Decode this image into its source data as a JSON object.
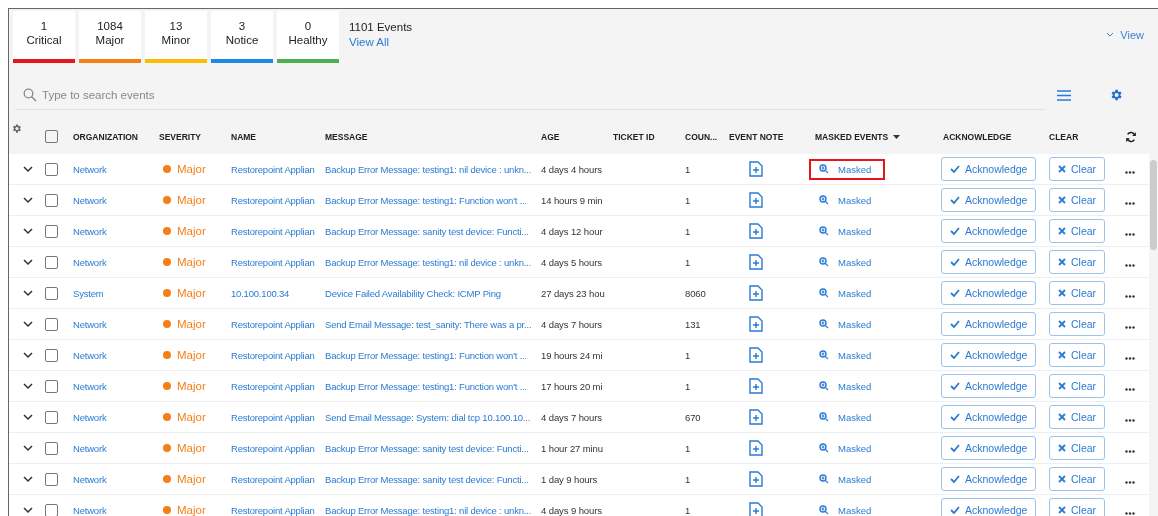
{
  "summary": [
    {
      "count": "1",
      "label": "Critical",
      "color": "#e8141c"
    },
    {
      "count": "1084",
      "label": "Major",
      "color": "#f57f17"
    },
    {
      "count": "13",
      "label": "Minor",
      "color": "#fbbc05"
    },
    {
      "count": "3",
      "label": "Notice",
      "color": "#1e88e5"
    },
    {
      "count": "0",
      "label": "Healthy",
      "color": "#4caf50"
    }
  ],
  "total_events": "1101 Events",
  "view_all": "View All",
  "view_button": "View",
  "search": {
    "placeholder": "Type to search events"
  },
  "select_all_checked": false,
  "columns": [
    {
      "label": "ORGANIZATION",
      "sorted": false
    },
    {
      "label": "SEVERITY",
      "sorted": false
    },
    {
      "label": "NAME",
      "sorted": false
    },
    {
      "label": "MESSAGE",
      "sorted": false
    },
    {
      "label": "AGE",
      "sorted": false
    },
    {
      "label": "TICKET ID",
      "sorted": false
    },
    {
      "label": "COUN...",
      "sorted": false
    },
    {
      "label": "EVENT NOTE",
      "sorted": false
    },
    {
      "label": "MASKED EVENTS",
      "sorted": true
    },
    {
      "label": "ACKNOWLEDGE",
      "sorted": false
    },
    {
      "label": "CLEAR",
      "sorted": false
    }
  ],
  "rows": [
    {
      "organization": "Network",
      "severity": "Major",
      "color": "#f57f17",
      "name": "Restorepoint Applian",
      "message": "Backup Error Message: testing1: nil device : unkn...",
      "age": "4 days 4 hours",
      "count": "1",
      "masked": "Masked",
      "highlighted": true,
      "acknowledge": "Acknowledge",
      "clear": "Clear",
      "checked": false
    },
    {
      "organization": "Network",
      "severity": "Major",
      "color": "#f57f17",
      "name": "Restorepoint Applian",
      "message": "Backup Error Message: testing1: Function won't ...",
      "age": "14 hours 9 min",
      "count": "1",
      "masked": "Masked",
      "highlighted": false,
      "acknowledge": "Acknowledge",
      "clear": "Clear",
      "checked": false
    },
    {
      "organization": "Network",
      "severity": "Major",
      "color": "#f57f17",
      "name": "Restorepoint Applian",
      "message": "Backup Error Message: sanity test device: Functi...",
      "age": "4 days 12 hour",
      "count": "1",
      "masked": "Masked",
      "highlighted": false,
      "acknowledge": "Acknowledge",
      "clear": "Clear",
      "checked": false
    },
    {
      "organization": "Network",
      "severity": "Major",
      "color": "#f57f17",
      "name": "Restorepoint Applian",
      "message": "Backup Error Message: testing1: nil device : unkn...",
      "age": "4 days 5 hours",
      "count": "1",
      "masked": "Masked",
      "highlighted": false,
      "acknowledge": "Acknowledge",
      "clear": "Clear",
      "checked": false
    },
    {
      "organization": "System",
      "severity": "Major",
      "color": "#f57f17",
      "name": "10.100.100.34",
      "message": "Device Failed Availability Check: ICMP Ping",
      "age": "27 days 23 hou",
      "count": "8060",
      "masked": "Masked",
      "highlighted": false,
      "acknowledge": "Acknowledge",
      "clear": "Clear",
      "checked": false
    },
    {
      "organization": "Network",
      "severity": "Major",
      "color": "#f57f17",
      "name": "Restorepoint Applian",
      "message": "Send Email Message: test_sanity: There was a pr...",
      "age": "4 days 7 hours",
      "count": "131",
      "masked": "Masked",
      "highlighted": false,
      "acknowledge": "Acknowledge",
      "clear": "Clear",
      "checked": false
    },
    {
      "organization": "Network",
      "severity": "Major",
      "color": "#f57f17",
      "name": "Restorepoint Applian",
      "message": "Backup Error Message: testing1: Function won't ...",
      "age": "19 hours 24 mi",
      "count": "1",
      "masked": "Masked",
      "highlighted": false,
      "acknowledge": "Acknowledge",
      "clear": "Clear",
      "checked": false
    },
    {
      "organization": "Network",
      "severity": "Major",
      "color": "#f57f17",
      "name": "Restorepoint Applian",
      "message": "Backup Error Message: testing1: Function won't ...",
      "age": "17 hours 20 mi",
      "count": "1",
      "masked": "Masked",
      "highlighted": false,
      "acknowledge": "Acknowledge",
      "clear": "Clear",
      "checked": false
    },
    {
      "organization": "Network",
      "severity": "Major",
      "color": "#f57f17",
      "name": "Restorepoint Applian",
      "message": "Send Email Message: System: dial tcp 10.100.10...",
      "age": "4 days 7 hours",
      "count": "670",
      "masked": "Masked",
      "highlighted": false,
      "acknowledge": "Acknowledge",
      "clear": "Clear",
      "checked": false
    },
    {
      "organization": "Network",
      "severity": "Major",
      "color": "#f57f17",
      "name": "Restorepoint Applian",
      "message": "Backup Error Message: sanity test device: Functi...",
      "age": "1 hour 27 minu",
      "count": "1",
      "masked": "Masked",
      "highlighted": false,
      "acknowledge": "Acknowledge",
      "clear": "Clear",
      "checked": false
    },
    {
      "organization": "Network",
      "severity": "Major",
      "color": "#f57f17",
      "name": "Restorepoint Applian",
      "message": "Backup Error Message: sanity test device: Functi...",
      "age": "1 day 9 hours",
      "count": "1",
      "masked": "Masked",
      "highlighted": false,
      "acknowledge": "Acknowledge",
      "clear": "Clear",
      "checked": false
    },
    {
      "organization": "Network",
      "severity": "Major",
      "color": "#f57f17",
      "name": "Restorepoint Applian",
      "message": "Backup Error Message: testing1: nil device : unkn...",
      "age": "4 days 9 hours",
      "count": "1",
      "masked": "Masked",
      "highlighted": false,
      "acknowledge": "Acknowledge",
      "clear": "Clear",
      "checked": false
    }
  ]
}
